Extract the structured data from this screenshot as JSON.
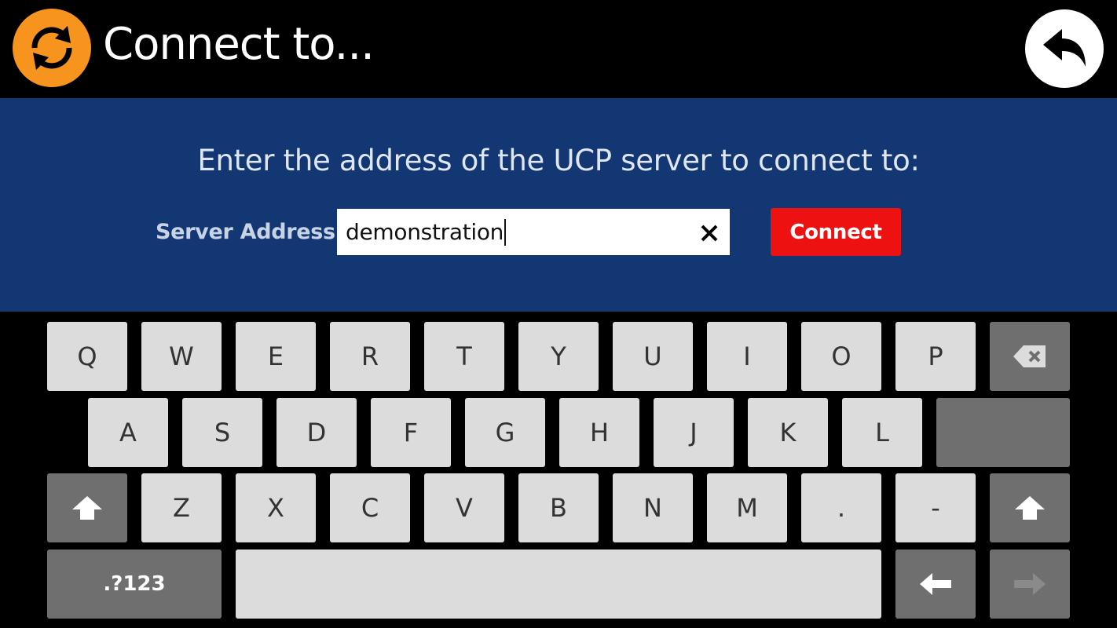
{
  "header": {
    "title": "Connect to...",
    "app_icon": "sync-icon",
    "back_icon": "back-arrow-icon"
  },
  "panel": {
    "prompt": "Enter the address of the UCP server to connect to:",
    "address_label": "Server Address",
    "address_value": "demonstration",
    "connect_label": "Connect"
  },
  "keyboard": {
    "row1": [
      "Q",
      "W",
      "E",
      "R",
      "T",
      "Y",
      "U",
      "I",
      "O",
      "P"
    ],
    "row2": [
      "A",
      "S",
      "D",
      "F",
      "G",
      "H",
      "J",
      "K",
      "L"
    ],
    "row3": [
      "Z",
      "X",
      "C",
      "V",
      "B",
      "N",
      "M",
      ".",
      "-"
    ],
    "symbols_label": ".?123",
    "icons": [
      "backspace-icon",
      "shift-icon",
      "left-arrow-icon",
      "right-arrow-icon"
    ]
  },
  "colors": {
    "accent_orange": "#f7941d",
    "panel_blue": "#123773",
    "connect_red": "#ee1111"
  }
}
